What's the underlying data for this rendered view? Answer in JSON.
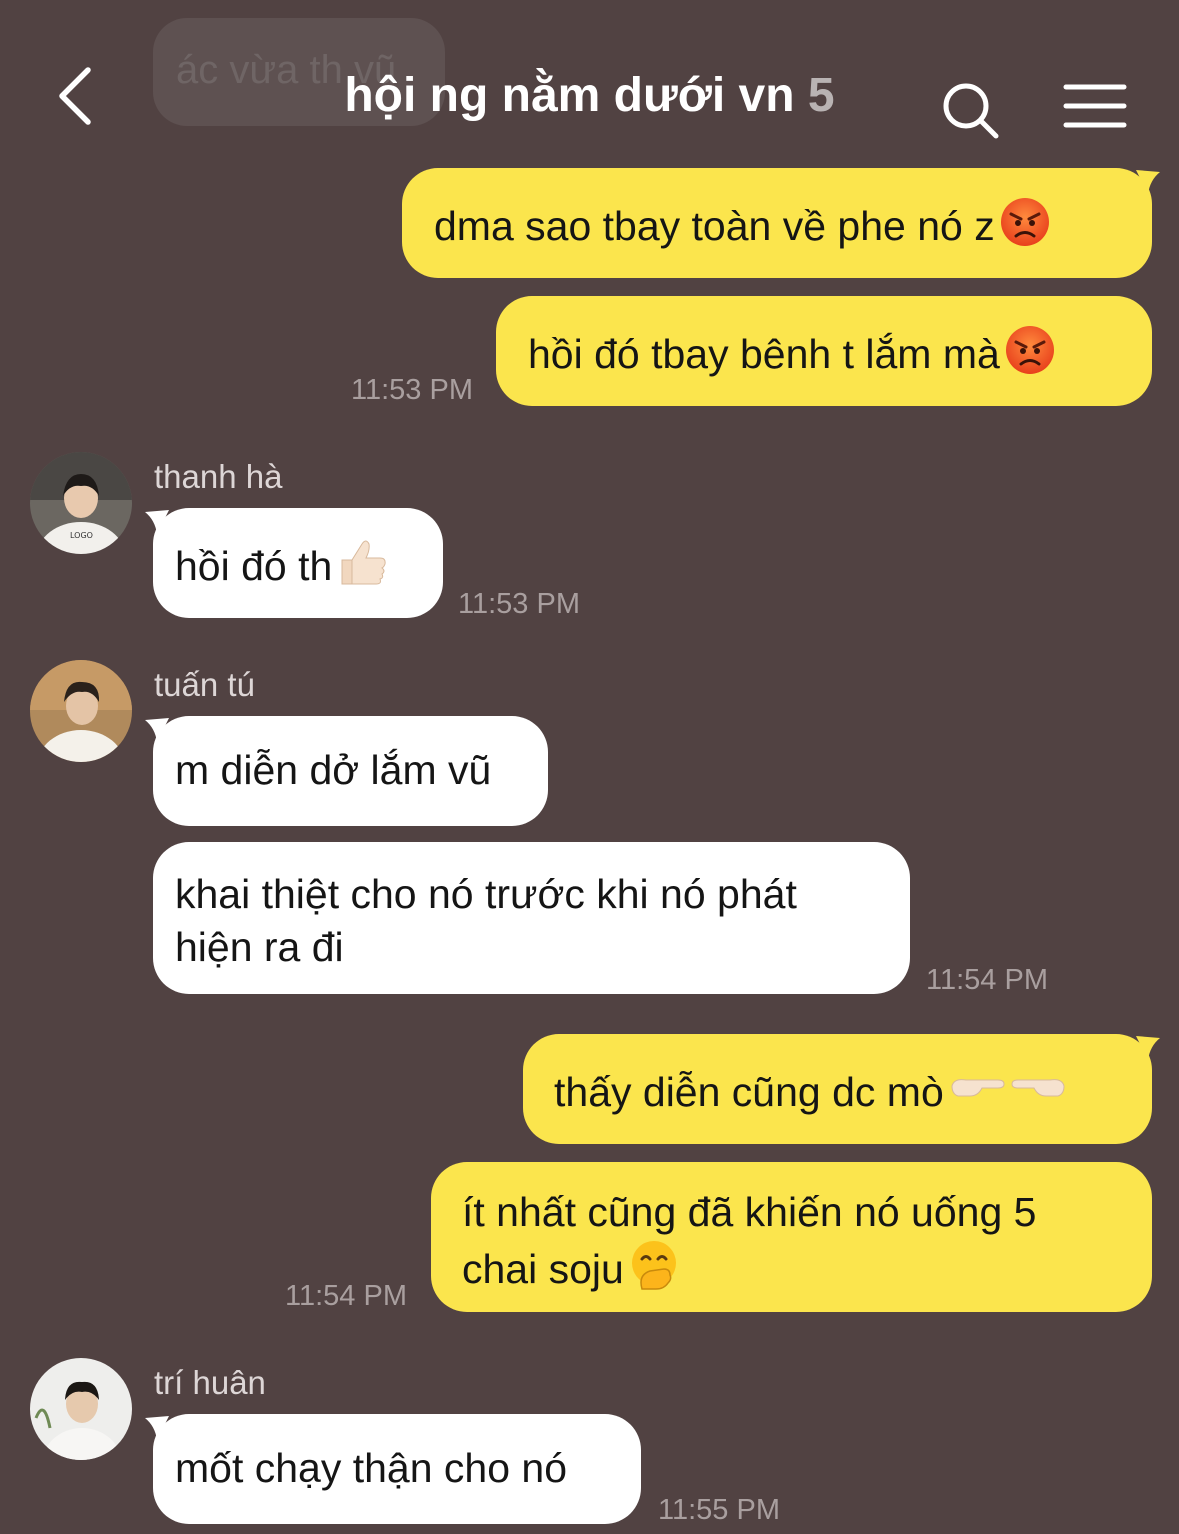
{
  "header": {
    "back_icon": "chevron-left-icon",
    "title": "hội ng nằm dưới vn",
    "member_count": "5",
    "search_icon": "search-icon",
    "menu_icon": "menu-icon"
  },
  "partial_message": "ác vừa th vũ",
  "messages": [
    {
      "sender": "me",
      "text": "dma sao tbay toàn về phe nó z",
      "emoji": "angry-face-emoji"
    },
    {
      "sender": "me",
      "text": "hồi đó tbay bênh t lắm mà",
      "emoji": "angry-face-emoji",
      "time": "11:53 PM"
    },
    {
      "sender": "thanh hà",
      "text": "hồi đó th",
      "emoji": "thumbs-up-emoji",
      "time": "11:53 PM"
    },
    {
      "sender": "tuấn tú",
      "text": "m diễn dở lắm vũ"
    },
    {
      "sender": "tuấn tú",
      "text_line1": "khai thiệt cho nó trước khi nó phát",
      "text_line2": "hiện ra đi",
      "time": "11:54 PM"
    },
    {
      "sender": "me",
      "text": "thấy diễn cũng dc mò",
      "emoji": "pointing-hands-emoji"
    },
    {
      "sender": "me",
      "text_line1": "ít nhất cũng đã khiến nó uống 5",
      "text_line2": "chai soju",
      "emoji": "hand-over-mouth-emoji",
      "time": "11:54 PM"
    },
    {
      "sender": "trí huân",
      "text": "mốt chạy thận cho nó",
      "time": "11:55 PM"
    }
  ],
  "colors": {
    "background": "#514242",
    "my_bubble": "#fbe54d",
    "their_bubble": "#ffffff"
  }
}
